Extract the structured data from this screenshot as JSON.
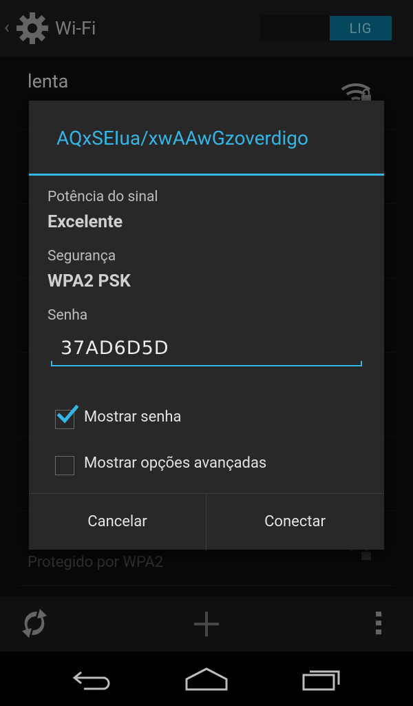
{
  "actionbar": {
    "title": "Wi-Fi",
    "switch_label": "LIG",
    "back_icon": "chevron-left-icon",
    "settings_icon": "gear-icon"
  },
  "list": {
    "top_network_name": "lenta",
    "bottom_network_security": "Protegido por WPA2"
  },
  "dialog": {
    "title": "AQxSEIua/xwAAwGzoverdigo",
    "signal_label": "Potência do sinal",
    "signal_value": "Excelente",
    "security_label": "Segurança",
    "security_value": "WPA2 PSK",
    "password_label": "Senha",
    "password_value": "37AD6D5D",
    "show_password_label": "Mostrar senha",
    "show_password_checked": true,
    "advanced_label": "Mostrar opções avançadas",
    "advanced_checked": false,
    "cancel_label": "Cancelar",
    "connect_label": "Conectar"
  },
  "bottombar": {
    "icons": [
      "wps-icon",
      "add-icon",
      "overflow-menu-icon"
    ]
  },
  "navbar": {
    "icons": [
      "back-icon",
      "home-icon",
      "recents-icon"
    ]
  },
  "colors": {
    "accent": "#33b5e5",
    "switch_on": "#0a6e8f",
    "dialog_bg": "#282828"
  }
}
